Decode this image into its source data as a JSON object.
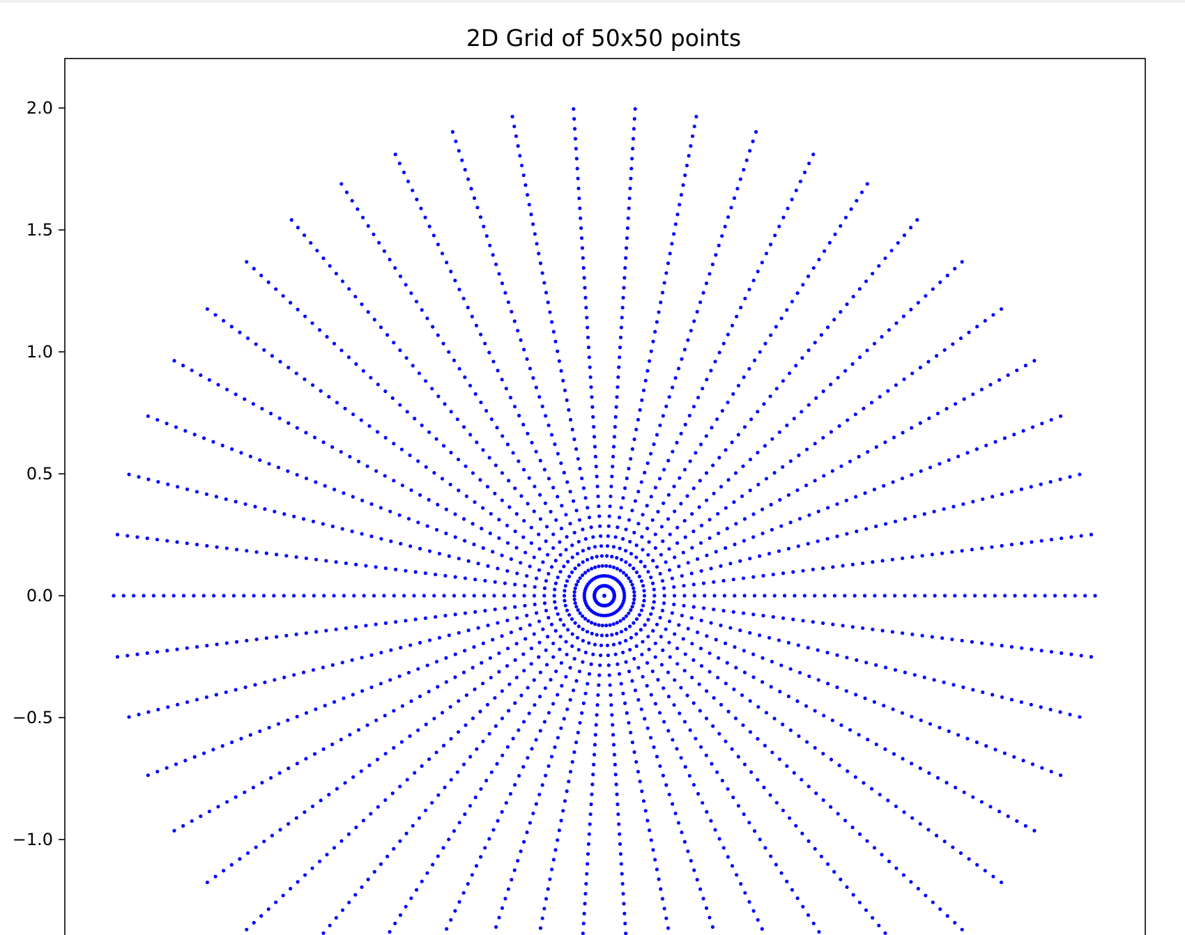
{
  "chart_data": {
    "type": "scatter",
    "title": "2D Grid of 50x50 points",
    "xlabel": "",
    "ylabel": "",
    "ylim": [
      -1.35,
      2.2
    ],
    "xlim": [
      -2.2,
      2.2
    ],
    "yticks": [
      "−1.0",
      "−0.5",
      "0.0",
      "0.5",
      "1.0",
      "1.5",
      "2.0"
    ],
    "ytick_values": [
      -1.0,
      -0.5,
      0.0,
      0.5,
      1.0,
      1.5,
      2.0
    ],
    "xticks": [],
    "grid": false,
    "legend": "none",
    "marker_color": "#0000ff",
    "pattern": {
      "description_values": "points at radius r in [0, 2] and angle theta in [0, 2pi), 50 x 50 samples, x = r*cos(theta), y = r*sin(theta)",
      "n_radius": 50,
      "n_angle": 50,
      "r_min": 0,
      "r_max": 2,
      "theta_min": 0,
      "theta_max": 6.283185307179586
    }
  },
  "colors": {
    "axes": "#000000",
    "background": "#ffffff",
    "points": "#0000ff"
  }
}
